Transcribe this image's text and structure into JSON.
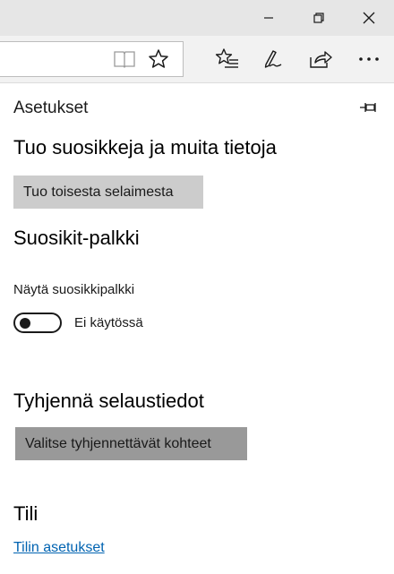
{
  "window_controls": {
    "minimize_icon": "minimize-icon",
    "restore_icon": "restore-icon",
    "close_icon": "close-icon"
  },
  "toolbar": {
    "reading_view_icon": "book-icon",
    "favorite_icon": "star-icon",
    "hub_icon": "favorites-list-icon",
    "notes_icon": "pen-icon",
    "share_icon": "share-icon",
    "more_icon": "ellipsis-icon",
    "more_label": "···"
  },
  "settings": {
    "title": "Asetukset",
    "pin_icon": "pin-icon",
    "import": {
      "heading": "Tuo suosikkeja ja muita tietoja",
      "button": "Tuo toisesta selaimesta"
    },
    "favorites_bar": {
      "heading": "Suosikit-palkki",
      "toggle_label": "Näytä suosikkipalkki",
      "toggle_state": "Ei käytössä",
      "toggle_on": false
    },
    "clear_data": {
      "heading": "Tyhjennä selaustiedot",
      "button": "Valitse tyhjennettävät kohteet"
    },
    "account": {
      "heading": "Tili",
      "link": "Tilin asetukset"
    }
  },
  "colors": {
    "titlebar": "#e6e6e6",
    "toolbar": "#f2f2f2",
    "button_gray": "#cccccc",
    "button_dark": "#999999",
    "link": "#0063b1"
  }
}
